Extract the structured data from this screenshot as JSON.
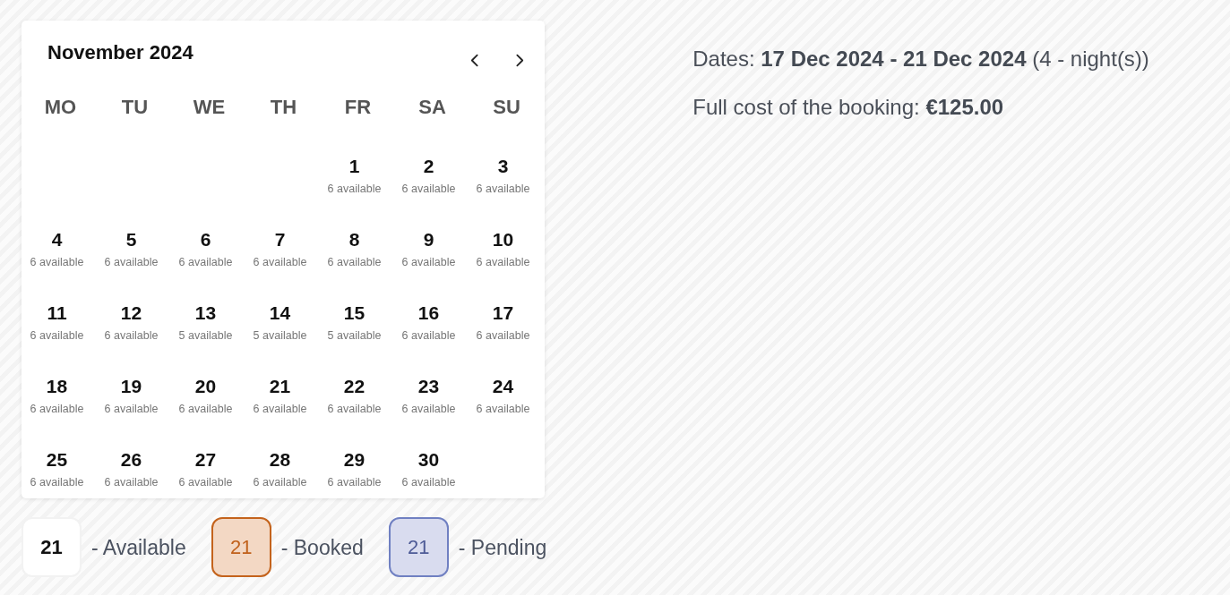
{
  "calendar": {
    "title": "November 2024",
    "weekdays": [
      "MO",
      "TU",
      "WE",
      "TH",
      "FR",
      "SA",
      "SU"
    ],
    "weeks": [
      [
        {
          "kind": "empty"
        },
        {
          "kind": "empty"
        },
        {
          "kind": "empty"
        },
        {
          "kind": "empty"
        },
        {
          "kind": "day",
          "day": "1",
          "availability": "6 available"
        },
        {
          "kind": "day",
          "day": "2",
          "availability": "6 available"
        },
        {
          "kind": "day",
          "day": "3",
          "availability": "6 available"
        }
      ],
      [
        {
          "kind": "day",
          "day": "4",
          "availability": "6 available"
        },
        {
          "kind": "day",
          "day": "5",
          "availability": "6 available"
        },
        {
          "kind": "day",
          "day": "6",
          "availability": "6 available"
        },
        {
          "kind": "day",
          "day": "7",
          "availability": "6 available"
        },
        {
          "kind": "day",
          "day": "8",
          "availability": "6 available"
        },
        {
          "kind": "day",
          "day": "9",
          "availability": "6 available"
        },
        {
          "kind": "day",
          "day": "10",
          "availability": "6 available"
        }
      ],
      [
        {
          "kind": "day",
          "day": "11",
          "availability": "6 available"
        },
        {
          "kind": "day",
          "day": "12",
          "availability": "6 available"
        },
        {
          "kind": "day",
          "day": "13",
          "availability": "5 available"
        },
        {
          "kind": "day",
          "day": "14",
          "availability": "5 available"
        },
        {
          "kind": "day",
          "day": "15",
          "availability": "5 available"
        },
        {
          "kind": "day",
          "day": "16",
          "availability": "6 available"
        },
        {
          "kind": "day",
          "day": "17",
          "availability": "6 available"
        }
      ],
      [
        {
          "kind": "day",
          "day": "18",
          "availability": "6 available"
        },
        {
          "kind": "day",
          "day": "19",
          "availability": "6 available"
        },
        {
          "kind": "day",
          "day": "20",
          "availability": "6 available"
        },
        {
          "kind": "day",
          "day": "21",
          "availability": "6 available"
        },
        {
          "kind": "day",
          "day": "22",
          "availability": "6 available"
        },
        {
          "kind": "day",
          "day": "23",
          "availability": "6 available"
        },
        {
          "kind": "day",
          "day": "24",
          "availability": "6 available"
        }
      ],
      [
        {
          "kind": "day",
          "day": "25",
          "availability": "6 available"
        },
        {
          "kind": "day",
          "day": "26",
          "availability": "6 available"
        },
        {
          "kind": "day",
          "day": "27",
          "availability": "6 available"
        },
        {
          "kind": "day",
          "day": "28",
          "availability": "6 available"
        },
        {
          "kind": "day",
          "day": "29",
          "availability": "6 available"
        },
        {
          "kind": "day",
          "day": "30",
          "availability": "6 available"
        },
        {
          "kind": "empty"
        }
      ]
    ]
  },
  "legend": [
    {
      "kind": "available",
      "day": "21",
      "label": "- Available"
    },
    {
      "kind": "booked",
      "day": "21",
      "label": "- Booked"
    },
    {
      "kind": "pending",
      "day": "21",
      "label": "- Pending"
    }
  ],
  "booking": {
    "dates": "Dates: **17 Dec 2024 - 21 Dec 2024** (4 - night(s))",
    "cost": "Full cost of the booking: **€125.00**"
  }
}
